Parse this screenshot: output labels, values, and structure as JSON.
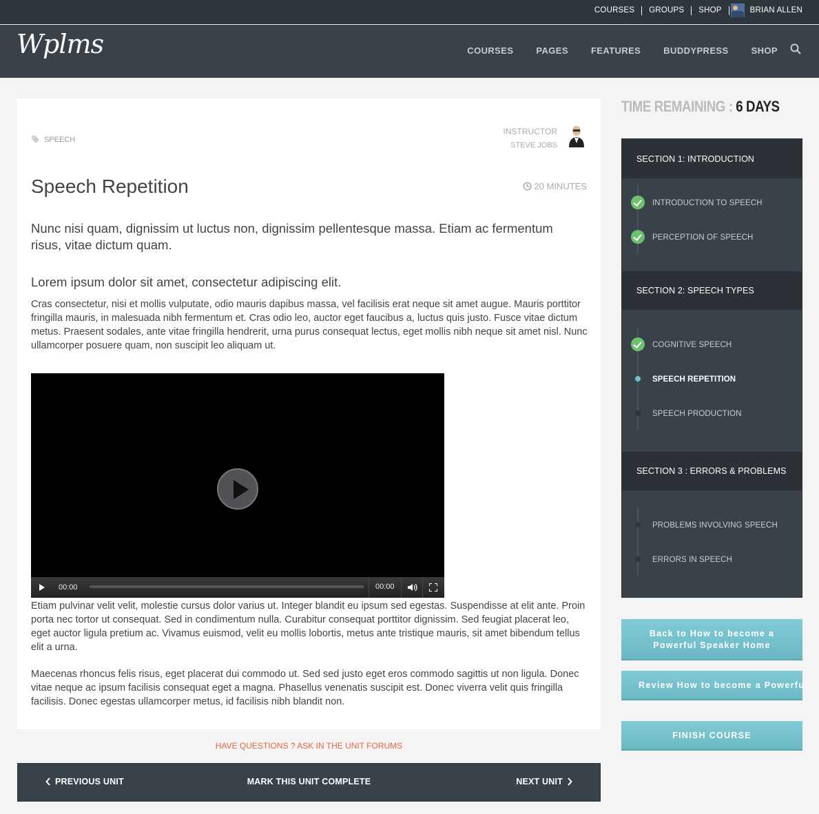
{
  "topbar": {
    "links": [
      "COURSES",
      "GROUPS",
      "SHOP"
    ],
    "user_name": "BRIAN ALLEN"
  },
  "header": {
    "logo": "Wplms",
    "nav": [
      "COURSES",
      "PAGES",
      "FEATURES",
      "BUDDYPRESS",
      "SHOP"
    ]
  },
  "unit": {
    "tag": "SPEECH",
    "instructor_label": "INSTRUCTOR",
    "instructor_name": "STEVE JOBS",
    "title": "Speech Repetition",
    "duration": "20 MINUTES",
    "lead": "Nunc nisi quam, dignissim ut luctus non, dignissim pellentesque massa. Etiam ac fermentum risus, vitae dictum quam.",
    "subheading": "Lorem ipsum dolor sit amet, consectetur adipiscing elit.",
    "para1": "Cras consectetur, nisi et mollis vulputate, odio mauris dapibus massa, vel facilisis erat neque sit amet augue. Mauris porttitor fringilla mauris, in malesuada nibh fermentum et. Cras odio leo, auctor eget faucibus a, luctus quis justo. Fusce vitae dictum metus. Praesent sodales, ante vitae fringilla hendrerit, urna purus consequat lectus, eget mollis nibh neque sit amet nisl. Nunc ullamcorper posuere quam, non suscipit leo aliquam ut.",
    "para2": "Etiam pulvinar velit velit, molestie cursus dolor varius ut. Integer blandit eu ipsum sed egestas. Suspendisse at elit ante. Proin porta nec tortor ut consequat. Sed in condimentum nulla. Curabitur consequat porttitor dignissim. Sed feugiat placerat leo, eget auctor ligula pretium ac. Vivamus euismod, velit eu mollis lobortis, metus ante tristique mauris, sit amet bibendum tellus elit a urna.",
    "para3": "Maecenas rhoncus felis risus, eget placerat dui commodo ut. Sed sed justo eget eros commodo sagittis ut non ligula. Donec vitae neque ac ipsum facilisis consequat eget a magna. Phasellus venenatis suscipit est. Donec viverra velit quis fringilla facilisis. Donec egestas ullamcorper metus, id facilisis nibh blandit non."
  },
  "video": {
    "current_time": "00:00",
    "duration": "00:00",
    "progress": 0
  },
  "forum_link": "HAVE QUESTIONS ? ASK IN THE UNIT FORUMS",
  "unit_nav": {
    "prev": "PREVIOUS UNIT",
    "mark": "MARK THIS UNIT COMPLETE",
    "next": "NEXT UNIT"
  },
  "timer": {
    "label": "TIME REMAINING :",
    "value": "6 DAYS"
  },
  "curriculum": {
    "sections": [
      {
        "title": "SECTION 1: INTRODUCTION",
        "items": [
          {
            "label": "INTRODUCTION TO SPEECH",
            "status": "done"
          },
          {
            "label": "PERCEPTION OF SPEECH",
            "status": "done"
          }
        ]
      },
      {
        "title": "SECTION 2: SPEECH TYPES",
        "items": [
          {
            "label": "COGNITIVE SPEECH",
            "status": "done"
          },
          {
            "label": "SPEECH REPETITION",
            "status": "current"
          },
          {
            "label": "SPEECH PRODUCTION",
            "status": "pending"
          }
        ]
      },
      {
        "title": "SECTION 3 : ERRORS & PROBLEMS",
        "items": [
          {
            "label": "PROBLEMS INVOLVING SPEECH",
            "status": "pending"
          },
          {
            "label": "ERRORS IN SPEECH",
            "status": "pending"
          }
        ]
      }
    ]
  },
  "buttons": {
    "back": "Back to How to become a Powerful Speaker Home",
    "review": "Review How to become a Powerful Speaker",
    "finish": "FINISH COURSE"
  },
  "colors": {
    "accent": "#72c1cf",
    "forum_link": "#e5653f",
    "done": "#6dc06d",
    "header": "#394248"
  }
}
